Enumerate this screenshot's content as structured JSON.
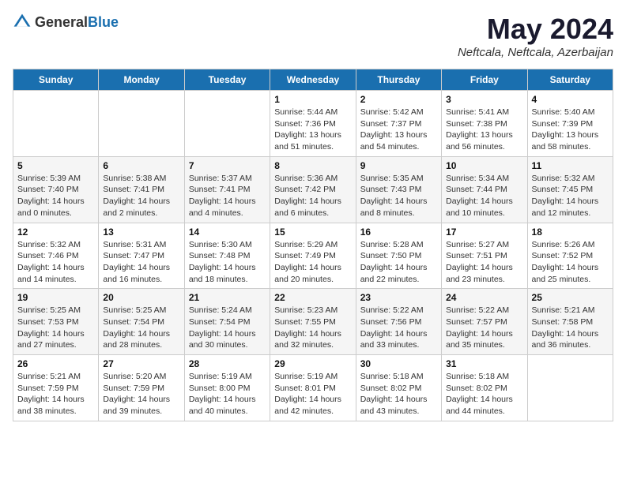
{
  "header": {
    "logo": {
      "general": "General",
      "blue": "Blue"
    },
    "title": "May 2024",
    "location": "Neftcala, Neftcala, Azerbaijan"
  },
  "calendar": {
    "days_of_week": [
      "Sunday",
      "Monday",
      "Tuesday",
      "Wednesday",
      "Thursday",
      "Friday",
      "Saturday"
    ],
    "weeks": [
      [
        {
          "day": "",
          "sunrise": "",
          "sunset": "",
          "daylight": ""
        },
        {
          "day": "",
          "sunrise": "",
          "sunset": "",
          "daylight": ""
        },
        {
          "day": "",
          "sunrise": "",
          "sunset": "",
          "daylight": ""
        },
        {
          "day": "1",
          "sunrise": "Sunrise: 5:44 AM",
          "sunset": "Sunset: 7:36 PM",
          "daylight": "Daylight: 13 hours and 51 minutes."
        },
        {
          "day": "2",
          "sunrise": "Sunrise: 5:42 AM",
          "sunset": "Sunset: 7:37 PM",
          "daylight": "Daylight: 13 hours and 54 minutes."
        },
        {
          "day": "3",
          "sunrise": "Sunrise: 5:41 AM",
          "sunset": "Sunset: 7:38 PM",
          "daylight": "Daylight: 13 hours and 56 minutes."
        },
        {
          "day": "4",
          "sunrise": "Sunrise: 5:40 AM",
          "sunset": "Sunset: 7:39 PM",
          "daylight": "Daylight: 13 hours and 58 minutes."
        }
      ],
      [
        {
          "day": "5",
          "sunrise": "Sunrise: 5:39 AM",
          "sunset": "Sunset: 7:40 PM",
          "daylight": "Daylight: 14 hours and 0 minutes."
        },
        {
          "day": "6",
          "sunrise": "Sunrise: 5:38 AM",
          "sunset": "Sunset: 7:41 PM",
          "daylight": "Daylight: 14 hours and 2 minutes."
        },
        {
          "day": "7",
          "sunrise": "Sunrise: 5:37 AM",
          "sunset": "Sunset: 7:41 PM",
          "daylight": "Daylight: 14 hours and 4 minutes."
        },
        {
          "day": "8",
          "sunrise": "Sunrise: 5:36 AM",
          "sunset": "Sunset: 7:42 PM",
          "daylight": "Daylight: 14 hours and 6 minutes."
        },
        {
          "day": "9",
          "sunrise": "Sunrise: 5:35 AM",
          "sunset": "Sunset: 7:43 PM",
          "daylight": "Daylight: 14 hours and 8 minutes."
        },
        {
          "day": "10",
          "sunrise": "Sunrise: 5:34 AM",
          "sunset": "Sunset: 7:44 PM",
          "daylight": "Daylight: 14 hours and 10 minutes."
        },
        {
          "day": "11",
          "sunrise": "Sunrise: 5:32 AM",
          "sunset": "Sunset: 7:45 PM",
          "daylight": "Daylight: 14 hours and 12 minutes."
        }
      ],
      [
        {
          "day": "12",
          "sunrise": "Sunrise: 5:32 AM",
          "sunset": "Sunset: 7:46 PM",
          "daylight": "Daylight: 14 hours and 14 minutes."
        },
        {
          "day": "13",
          "sunrise": "Sunrise: 5:31 AM",
          "sunset": "Sunset: 7:47 PM",
          "daylight": "Daylight: 14 hours and 16 minutes."
        },
        {
          "day": "14",
          "sunrise": "Sunrise: 5:30 AM",
          "sunset": "Sunset: 7:48 PM",
          "daylight": "Daylight: 14 hours and 18 minutes."
        },
        {
          "day": "15",
          "sunrise": "Sunrise: 5:29 AM",
          "sunset": "Sunset: 7:49 PM",
          "daylight": "Daylight: 14 hours and 20 minutes."
        },
        {
          "day": "16",
          "sunrise": "Sunrise: 5:28 AM",
          "sunset": "Sunset: 7:50 PM",
          "daylight": "Daylight: 14 hours and 22 minutes."
        },
        {
          "day": "17",
          "sunrise": "Sunrise: 5:27 AM",
          "sunset": "Sunset: 7:51 PM",
          "daylight": "Daylight: 14 hours and 23 minutes."
        },
        {
          "day": "18",
          "sunrise": "Sunrise: 5:26 AM",
          "sunset": "Sunset: 7:52 PM",
          "daylight": "Daylight: 14 hours and 25 minutes."
        }
      ],
      [
        {
          "day": "19",
          "sunrise": "Sunrise: 5:25 AM",
          "sunset": "Sunset: 7:53 PM",
          "daylight": "Daylight: 14 hours and 27 minutes."
        },
        {
          "day": "20",
          "sunrise": "Sunrise: 5:25 AM",
          "sunset": "Sunset: 7:54 PM",
          "daylight": "Daylight: 14 hours and 28 minutes."
        },
        {
          "day": "21",
          "sunrise": "Sunrise: 5:24 AM",
          "sunset": "Sunset: 7:54 PM",
          "daylight": "Daylight: 14 hours and 30 minutes."
        },
        {
          "day": "22",
          "sunrise": "Sunrise: 5:23 AM",
          "sunset": "Sunset: 7:55 PM",
          "daylight": "Daylight: 14 hours and 32 minutes."
        },
        {
          "day": "23",
          "sunrise": "Sunrise: 5:22 AM",
          "sunset": "Sunset: 7:56 PM",
          "daylight": "Daylight: 14 hours and 33 minutes."
        },
        {
          "day": "24",
          "sunrise": "Sunrise: 5:22 AM",
          "sunset": "Sunset: 7:57 PM",
          "daylight": "Daylight: 14 hours and 35 minutes."
        },
        {
          "day": "25",
          "sunrise": "Sunrise: 5:21 AM",
          "sunset": "Sunset: 7:58 PM",
          "daylight": "Daylight: 14 hours and 36 minutes."
        }
      ],
      [
        {
          "day": "26",
          "sunrise": "Sunrise: 5:21 AM",
          "sunset": "Sunset: 7:59 PM",
          "daylight": "Daylight: 14 hours and 38 minutes."
        },
        {
          "day": "27",
          "sunrise": "Sunrise: 5:20 AM",
          "sunset": "Sunset: 7:59 PM",
          "daylight": "Daylight: 14 hours and 39 minutes."
        },
        {
          "day": "28",
          "sunrise": "Sunrise: 5:19 AM",
          "sunset": "Sunset: 8:00 PM",
          "daylight": "Daylight: 14 hours and 40 minutes."
        },
        {
          "day": "29",
          "sunrise": "Sunrise: 5:19 AM",
          "sunset": "Sunset: 8:01 PM",
          "daylight": "Daylight: 14 hours and 42 minutes."
        },
        {
          "day": "30",
          "sunrise": "Sunrise: 5:18 AM",
          "sunset": "Sunset: 8:02 PM",
          "daylight": "Daylight: 14 hours and 43 minutes."
        },
        {
          "day": "31",
          "sunrise": "Sunrise: 5:18 AM",
          "sunset": "Sunset: 8:02 PM",
          "daylight": "Daylight: 14 hours and 44 minutes."
        },
        {
          "day": "",
          "sunrise": "",
          "sunset": "",
          "daylight": ""
        }
      ]
    ]
  }
}
